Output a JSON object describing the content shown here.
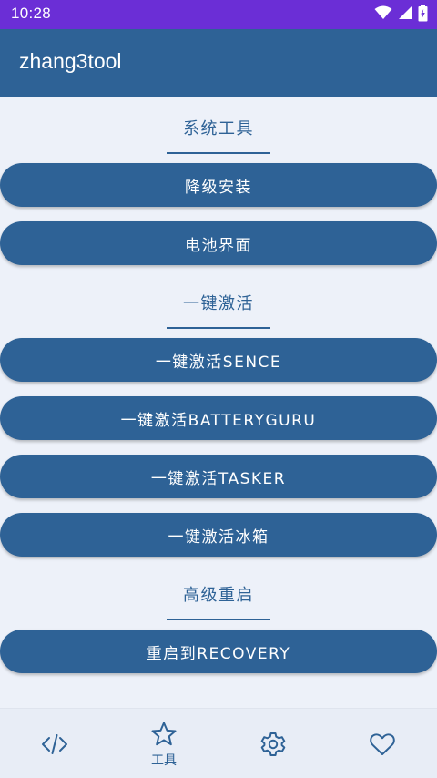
{
  "status_bar": {
    "time": "10:28",
    "icons": [
      "wifi-icon",
      "cellular-signal-icon",
      "battery-icon"
    ]
  },
  "app_bar": {
    "title": "zhang3tool"
  },
  "sections": [
    {
      "title": "系统工具",
      "buttons": [
        "降级安装",
        "电池界面"
      ]
    },
    {
      "title": "一键激活",
      "buttons": [
        "一键激活SENCE",
        "一键激活BATTERYGURU",
        "一键激活TASKER",
        "一键激活冰箱"
      ]
    },
    {
      "title": "高级重启",
      "buttons": [
        "重启到RECOVERY"
      ]
    }
  ],
  "bottom_nav": {
    "items": [
      {
        "icon": "code-icon",
        "label": ""
      },
      {
        "icon": "star-icon",
        "label": "工具",
        "selected": true
      },
      {
        "icon": "gear-icon",
        "label": ""
      },
      {
        "icon": "heart-icon",
        "label": ""
      }
    ]
  },
  "colors": {
    "status_bar": "#6b2ed6",
    "primary": "#2e6296",
    "background": "#edf1f9",
    "nav_background": "#e8edf6"
  }
}
